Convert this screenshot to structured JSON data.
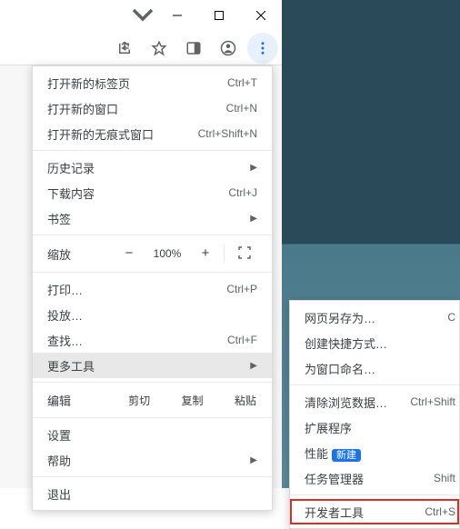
{
  "window": {
    "minimize": "—",
    "maximize": "☐",
    "close": "✕"
  },
  "menu": {
    "new_tab": {
      "label": "打开新的标签页",
      "shortcut": "Ctrl+T"
    },
    "new_window": {
      "label": "打开新的窗口",
      "shortcut": "Ctrl+N"
    },
    "new_incognito": {
      "label": "打开新的无痕式窗口",
      "shortcut": "Ctrl+Shift+N"
    },
    "history": {
      "label": "历史记录"
    },
    "downloads": {
      "label": "下载内容",
      "shortcut": "Ctrl+J"
    },
    "bookmarks": {
      "label": "书签"
    },
    "zoom": {
      "label": "缩放",
      "value": "100%"
    },
    "print": {
      "label": "打印…",
      "shortcut": "Ctrl+P"
    },
    "cast": {
      "label": "投放…"
    },
    "find": {
      "label": "查找…",
      "shortcut": "Ctrl+F"
    },
    "more_tools": {
      "label": "更多工具"
    },
    "edit": {
      "label": "编辑",
      "cut": "剪切",
      "copy": "复制",
      "paste": "粘贴"
    },
    "settings": {
      "label": "设置"
    },
    "help": {
      "label": "帮助"
    },
    "exit": {
      "label": "退出"
    }
  },
  "submenu": {
    "save_page": {
      "label": "网页另存为…",
      "shortcut": "C"
    },
    "create_shortcut": {
      "label": "创建快捷方式…"
    },
    "name_window": {
      "label": "为窗口命名…"
    },
    "clear_data": {
      "label": "清除浏览数据…",
      "shortcut": "Ctrl+Shift"
    },
    "extensions": {
      "label": "扩展程序"
    },
    "performance": {
      "label": "性能",
      "badge": "新建"
    },
    "task_manager": {
      "label": "任务管理器",
      "shortcut": "Shift"
    },
    "dev_tools": {
      "label": "开发者工具",
      "shortcut": "Ctrl+S"
    }
  }
}
